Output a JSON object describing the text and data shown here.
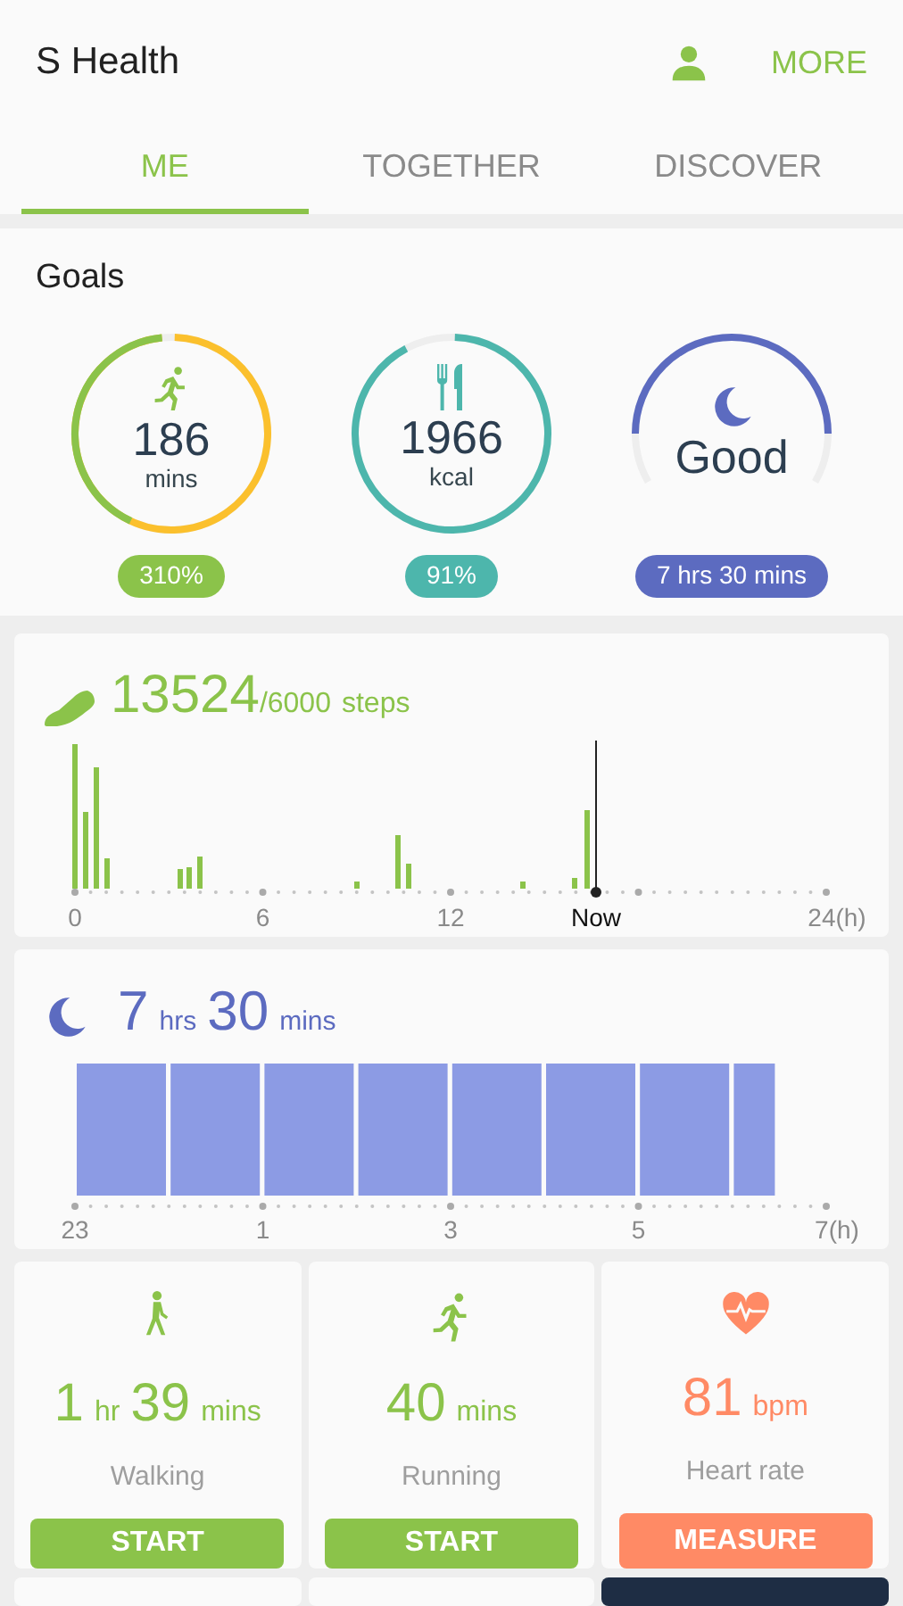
{
  "app_bar": {
    "title": "S Health",
    "more": "MORE"
  },
  "tabs": [
    {
      "label": "ME",
      "selected": true
    },
    {
      "label": "TOGETHER",
      "selected": false
    },
    {
      "label": "DISCOVER",
      "selected": false
    }
  ],
  "goals": {
    "title": "Goals",
    "items": [
      {
        "kind": "activity",
        "value": "186",
        "unit": "mins",
        "badge": "310%",
        "color": "#8bc34a"
      },
      {
        "kind": "food",
        "value": "1966",
        "unit": "kcal",
        "badge": "91%",
        "color": "#4db6ac"
      },
      {
        "kind": "sleep",
        "value": "Good",
        "badge": "7 hrs 30 mins",
        "color": "#5c6bc0"
      }
    ]
  },
  "steps": {
    "count": "13524",
    "goal": "/6000",
    "unit": "steps",
    "axis_labels": [
      "0",
      "6",
      "12",
      "Now",
      "24(h)"
    ]
  },
  "sleep": {
    "parts": [
      {
        "text": "7",
        "kind": "number"
      },
      {
        "text": "hrs",
        "kind": "unit"
      },
      {
        "text": "30",
        "kind": "number"
      },
      {
        "text": "mins",
        "kind": "unit"
      }
    ],
    "axis_labels": [
      "23",
      "1",
      "3",
      "5",
      "7(h)"
    ]
  },
  "tiles": [
    {
      "kind": "walking",
      "color": "#8bc34a",
      "parts": [
        {
          "text": "1",
          "kind": "number"
        },
        {
          "text": "hr",
          "kind": "unit"
        },
        {
          "text": "39",
          "kind": "number"
        },
        {
          "text": "mins",
          "kind": "unit"
        }
      ],
      "label": "Walking",
      "button": "START"
    },
    {
      "kind": "running",
      "color": "#8bc34a",
      "parts": [
        {
          "text": "40",
          "kind": "number"
        },
        {
          "text": "mins",
          "kind": "unit"
        }
      ],
      "label": "Running",
      "button": "START"
    },
    {
      "kind": "heart",
      "color": "#ff8a65",
      "parts": [
        {
          "text": "81",
          "kind": "number"
        },
        {
          "text": "bpm",
          "kind": "unit"
        }
      ],
      "label": "Heart rate",
      "button": "MEASURE"
    }
  ]
}
